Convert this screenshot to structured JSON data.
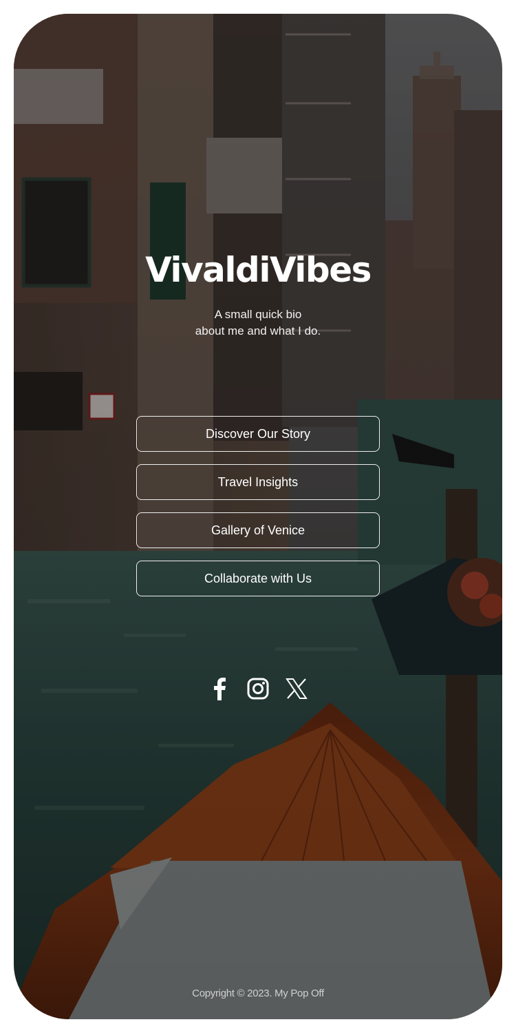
{
  "profile": {
    "title": "VivaldiVibes",
    "bio_line1": "A small quick bio",
    "bio_line2": "about me and what I do."
  },
  "links": [
    {
      "label": "Discover Our Story"
    },
    {
      "label": "Travel Insights"
    },
    {
      "label": "Gallery of Venice"
    },
    {
      "label": "Collaborate with Us"
    }
  ],
  "social": [
    {
      "icon": "facebook-icon"
    },
    {
      "icon": "instagram-icon"
    },
    {
      "icon": "x-icon"
    }
  ],
  "footer": {
    "copyright": "Copyright © 2023. My Pop Off"
  },
  "colors": {
    "text": "#ffffff",
    "water": "#2f4c44",
    "boat_wood": "#8a3814",
    "boat_cover": "#8e9393"
  }
}
